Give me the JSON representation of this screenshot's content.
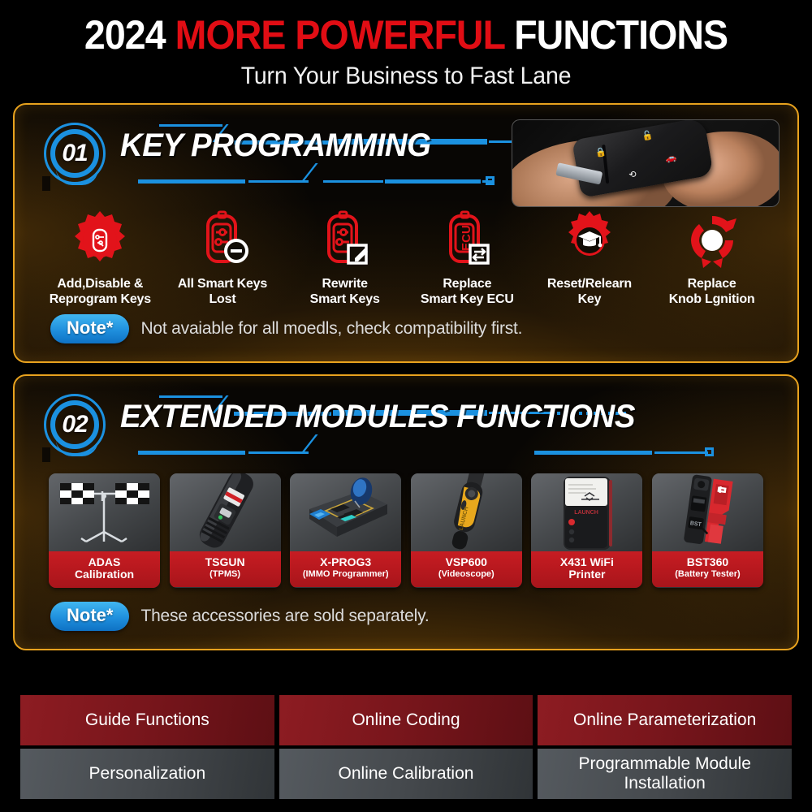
{
  "header": {
    "title_year": "2024",
    "title_highlight": "MORE POWERFUL",
    "title_tail": "FUNCTIONS",
    "subtitle": "Turn Your Business to Fast Lane",
    "accent_red": "#e10d14",
    "accent_blue": "#1b91e0",
    "accent_amber": "#e8a21e"
  },
  "sections": [
    {
      "number": "01",
      "title": "KEY PROGRAMMING",
      "photo_alt": "hand-holding-car-key-fob",
      "note_label": "Note*",
      "note_text": "Not avaiable for all moedls, check compatibility first.",
      "features": [
        {
          "icon": "gear-key-icon",
          "line1": "Add,Disable &",
          "line2": "Reprogram Keys"
        },
        {
          "icon": "key-minus-icon",
          "line1": "All Smart Keys",
          "line2": "Lost"
        },
        {
          "icon": "key-pencil-icon",
          "line1": "Rewrite",
          "line2": "Smart Keys"
        },
        {
          "icon": "key-ecu-swap-icon",
          "line1": "Replace",
          "line2": "Smart Key ECU"
        },
        {
          "icon": "gear-graduation-icon",
          "line1": "Reset/Relearn",
          "line2": "Key"
        },
        {
          "icon": "knob-rotate-icon",
          "line1": "Replace",
          "line2": "Knob Lgnition"
        }
      ]
    },
    {
      "number": "02",
      "title": "EXTENDED MODULES FUNCTIONS",
      "note_label": "Note*",
      "note_text": "These accessories are sold separately.",
      "products": [
        {
          "image": "adas-calibration-frame-image",
          "name": "ADAS",
          "name2": "Calibration",
          "sub": ""
        },
        {
          "image": "tsgun-tpms-tool-image",
          "name": "TSGUN",
          "name2": "",
          "sub": "(TPMS)"
        },
        {
          "image": "xprog3-immo-programmer-image",
          "name": "X-PROG3",
          "name2": "",
          "sub": "(IMMO Programmer)"
        },
        {
          "image": "vsp600-videoscope-image",
          "name": "VSP600",
          "name2": "",
          "sub": "(Videoscope)"
        },
        {
          "image": "x431-wifi-printer-image",
          "name": "X431 WiFi",
          "name2": "Printer",
          "sub": ""
        },
        {
          "image": "bst360-battery-tester-image",
          "name": "BST360",
          "name2": "",
          "sub": "(Battery Tester)"
        }
      ]
    }
  ],
  "bottom_grid": {
    "red_row": [
      "Guide Functions",
      "Online Coding",
      "Online Parameterization"
    ],
    "gray_row": [
      "Personalization",
      "Online Calibration",
      "Programmable Module Installation"
    ],
    "red_color": "#8d1c22",
    "gray_color": "#4b5055"
  }
}
